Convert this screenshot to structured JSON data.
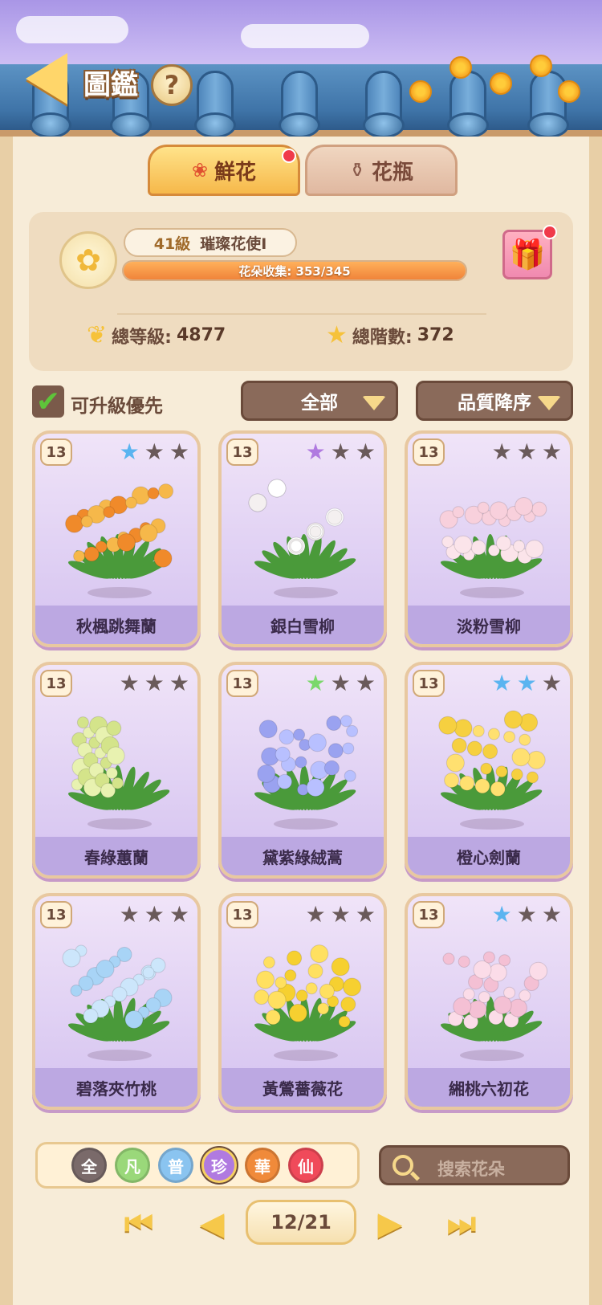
{
  "header": {
    "title": "圖鑑",
    "help": "?"
  },
  "tabs": [
    {
      "label": "鮮花",
      "icon": "rose-icon",
      "active": true,
      "has_dot": true
    },
    {
      "label": "花瓶",
      "icon": "vase-icon",
      "active": false,
      "has_dot": false
    }
  ],
  "profile": {
    "level": "41級",
    "rank": "璀璨花使I",
    "collection_label": "花朵收集: 353/345",
    "collection_progress": 1.0,
    "total_level_label": "總等級:",
    "total_level": "4877",
    "total_stars_label": "總階數:",
    "total_stars": "372"
  },
  "filters": {
    "upgrade_first_label": "可升級優先",
    "upgrade_first_checked": true,
    "category": "全部",
    "sort": "品質降序"
  },
  "cards": [
    {
      "level": "13",
      "name": "秋楓跳舞蘭",
      "stars": [
        "blue",
        "dark",
        "dark"
      ],
      "colors": [
        "#f08a2a",
        "#f6b84a",
        "#e0602a"
      ]
    },
    {
      "level": "13",
      "name": "銀白雪柳",
      "stars": [
        "purple",
        "dark",
        "dark"
      ],
      "colors": [
        "#ffffff",
        "#f4f0f0",
        "#6a4a3a"
      ]
    },
    {
      "level": "13",
      "name": "淡粉雪柳",
      "stars": [
        "dark",
        "dark",
        "dark"
      ],
      "colors": [
        "#f8d0dc",
        "#fbe4ea",
        "#6a4a3a"
      ]
    },
    {
      "level": "13",
      "name": "春綠蕙蘭",
      "stars": [
        "dark",
        "dark",
        "dark"
      ],
      "colors": [
        "#e8f2b0",
        "#d4e48a",
        "#3a7a2a"
      ]
    },
    {
      "level": "13",
      "name": "黛紫綠絨蒿",
      "stars": [
        "green",
        "dark",
        "dark"
      ],
      "colors": [
        "#9aa2f0",
        "#b8c0ff",
        "#3a7a2a"
      ]
    },
    {
      "level": "13",
      "name": "橙心劍蘭",
      "stars": [
        "blue",
        "blue",
        "dark"
      ],
      "colors": [
        "#f6d040",
        "#ffe070",
        "#3a7a2a"
      ]
    },
    {
      "level": "13",
      "name": "碧落夾竹桃",
      "stars": [
        "dark",
        "dark",
        "dark"
      ],
      "colors": [
        "#a8d4f6",
        "#cce6fb",
        "#3a7a2a"
      ]
    },
    {
      "level": "13",
      "name": "黃鶯薔薇花",
      "stars": [
        "dark",
        "dark",
        "dark"
      ],
      "colors": [
        "#f6d030",
        "#ffe060",
        "#3a7a2a"
      ]
    },
    {
      "level": "13",
      "name": "緗桃六初花",
      "stars": [
        "blue",
        "dark",
        "dark"
      ],
      "colors": [
        "#f4c0d4",
        "#fbdce8",
        "#3a7a2a"
      ]
    }
  ],
  "rarity": [
    {
      "label": "全",
      "color": "#7a6a6a",
      "selected": false
    },
    {
      "label": "凡",
      "color": "#9ad87a",
      "selected": false
    },
    {
      "label": "普",
      "color": "#8ac4f0",
      "selected": false
    },
    {
      "label": "珍",
      "color": "#b07ae0",
      "selected": true
    },
    {
      "label": "華",
      "color": "#f08a3a",
      "selected": false
    },
    {
      "label": "仙",
      "color": "#f04a5a",
      "selected": false
    }
  ],
  "search": {
    "placeholder": "搜索花朵"
  },
  "pager": {
    "page": "12/21"
  }
}
